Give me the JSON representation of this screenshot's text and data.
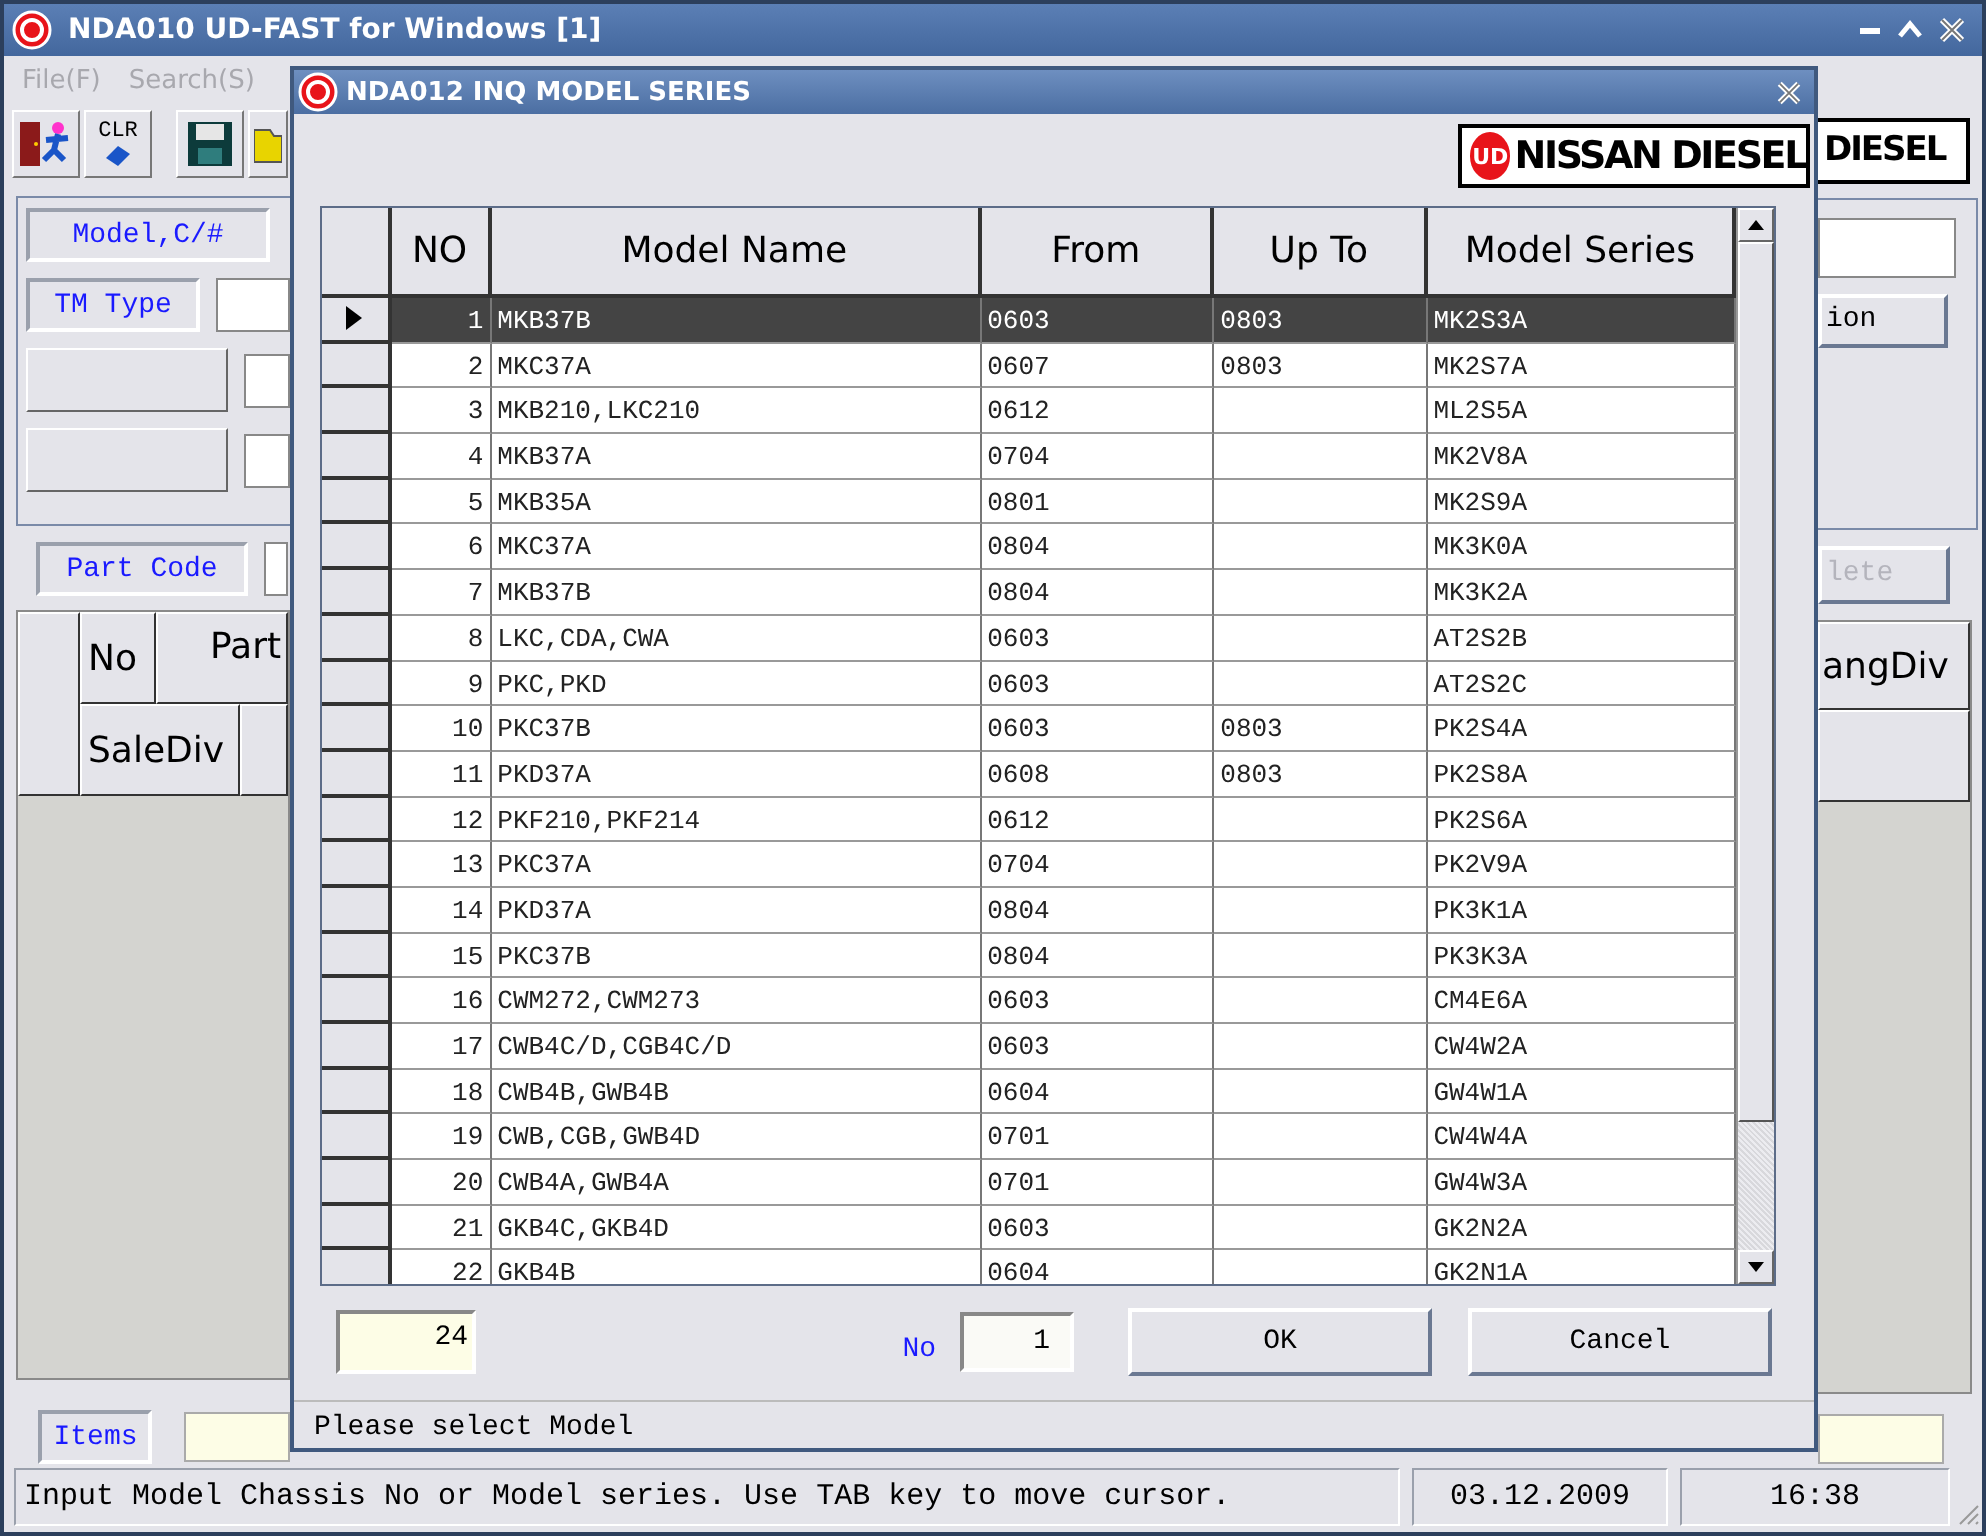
{
  "main_window": {
    "title": "NDA010 UD-FAST for Windows [1]",
    "menu": [
      {
        "label": "File(F)",
        "disabled": true
      },
      {
        "label": "Search(S)",
        "disabled": true
      }
    ],
    "toolbar": {
      "clear_button": "CLR"
    },
    "form": {
      "model_label": "Model,C/#",
      "tm_type_label": "TM Type",
      "right_button": "ion",
      "part_code_label": "Part Code",
      "delete_button": {
        "label": "lete",
        "disabled": true
      }
    },
    "logo": "DIESEL",
    "grid": {
      "header_top": [
        "No",
        "Part"
      ],
      "header_right": "angDiv",
      "header_bottom": "SaleDiv"
    },
    "items_label": "Items",
    "status_bar": {
      "message": "Input Model Chassis No or Model series. Use TAB key to move cursor.",
      "date": "03.12.2009",
      "time": "16:38"
    }
  },
  "dialog": {
    "title": "NDA012 INQ MODEL SERIES",
    "logo": {
      "badge": "UD",
      "text": "NISSAN DIESEL"
    },
    "columns": [
      "NO",
      "Model Name",
      "From",
      "Up To",
      "Model Series"
    ],
    "rows": [
      {
        "no": "1",
        "model_name": "MKB37B",
        "from": "0603",
        "up_to": "0803",
        "model_series": "MK2S3A",
        "selected": true
      },
      {
        "no": "2",
        "model_name": "MKC37A",
        "from": "0607",
        "up_to": "0803",
        "model_series": "MK2S7A",
        "selected": false
      },
      {
        "no": "3",
        "model_name": "MKB210,LKC210",
        "from": "0612",
        "model_series": "ML2S5A",
        "selected": false
      },
      {
        "no": "4",
        "model_name": "MKB37A",
        "from": "0704",
        "model_series": "MK2V8A",
        "selected": false
      },
      {
        "no": "5",
        "model_name": "MKB35A",
        "from": "0801",
        "model_series": "MK2S9A",
        "selected": false
      },
      {
        "no": "6",
        "model_name": "MKC37A",
        "from": "0804",
        "model_series": "MK3K0A",
        "selected": false
      },
      {
        "no": "7",
        "model_name": "MKB37B",
        "from": "0804",
        "model_series": "MK3K2A",
        "selected": false
      },
      {
        "no": "8",
        "model_name": "LKC,CDA,CWA",
        "from": "0603",
        "model_series": "AT2S2B",
        "selected": false
      },
      {
        "no": "9",
        "model_name": "PKC,PKD",
        "from": "0603",
        "model_series": "AT2S2C",
        "selected": false
      },
      {
        "no": "10",
        "model_name": "PKC37B",
        "from": "0603",
        "up_to": "0803",
        "model_series": "PK2S4A",
        "selected": false
      },
      {
        "no": "11",
        "model_name": "PKD37A",
        "from": "0608",
        "up_to": "0803",
        "model_series": "PK2S8A",
        "selected": false
      },
      {
        "no": "12",
        "model_name": "PKF210,PKF214",
        "from": "0612",
        "model_series": "PK2S6A",
        "selected": false
      },
      {
        "no": "13",
        "model_name": "PKC37A",
        "from": "0704",
        "model_series": "PK2V9A",
        "selected": false
      },
      {
        "no": "14",
        "model_name": "PKD37A",
        "from": "0804",
        "model_series": "PK3K1A",
        "selected": false
      },
      {
        "no": "15",
        "model_name": "PKC37B",
        "from": "0804",
        "model_series": "PK3K3A",
        "selected": false
      },
      {
        "no": "16",
        "model_name": "CWM272,CWM273",
        "from": "0603",
        "model_series": "CM4E6A",
        "selected": false
      },
      {
        "no": "17",
        "model_name": "CWB4C/D,CGB4C/D",
        "from": "0603",
        "model_series": "CW4W2A",
        "selected": false
      },
      {
        "no": "18",
        "model_name": "CWB4B,GWB4B",
        "from": "0604",
        "model_series": "GW4W1A",
        "selected": false
      },
      {
        "no": "19",
        "model_name": "CWB,CGB,GWB4D",
        "from": "0701",
        "model_series": "CW4W4A",
        "selected": false
      },
      {
        "no": "20",
        "model_name": "CWB4A,GWB4A",
        "from": "0701",
        "model_series": "GW4W3A",
        "selected": false
      },
      {
        "no": "21",
        "model_name": "GKB4C,GKB4D",
        "from": "0603",
        "model_series": "GK2N2A",
        "selected": false
      },
      {
        "no": "22",
        "model_name": "GKB4B",
        "from": "0604",
        "model_series": "GK2N1A",
        "selected": false
      }
    ],
    "count": "24",
    "no_label": "No",
    "no_value": "1",
    "buttons": [
      "OK",
      "Cancel"
    ],
    "status": "Please select Model"
  }
}
